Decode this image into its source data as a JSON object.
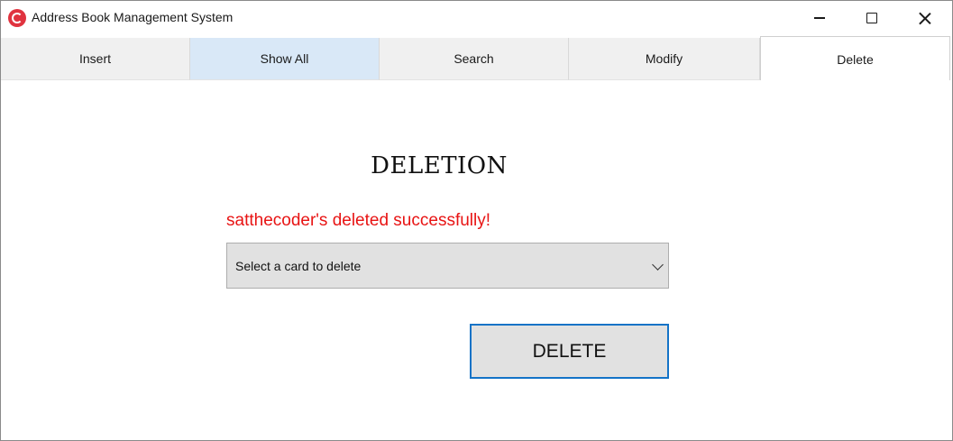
{
  "window": {
    "title": "Address Book Management System",
    "icon": "app-c-icon"
  },
  "tabs": [
    {
      "label": "Insert",
      "state": "normal"
    },
    {
      "label": "Show All",
      "state": "hover"
    },
    {
      "label": "Search",
      "state": "normal"
    },
    {
      "label": "Modify",
      "state": "normal"
    },
    {
      "label": "Delete",
      "state": "selected"
    }
  ],
  "main": {
    "heading": "DELETION",
    "status_message": "satthecoder's deleted successfully!",
    "select": {
      "placeholder": "Select a card to delete",
      "icon": "chevron-down-icon"
    },
    "delete_button_label": "DELETE"
  },
  "colors": {
    "status_text": "#e81414",
    "focus_border": "#1473c7",
    "hover_tab": "#d9e8f7",
    "app_icon": "#e0333f"
  }
}
